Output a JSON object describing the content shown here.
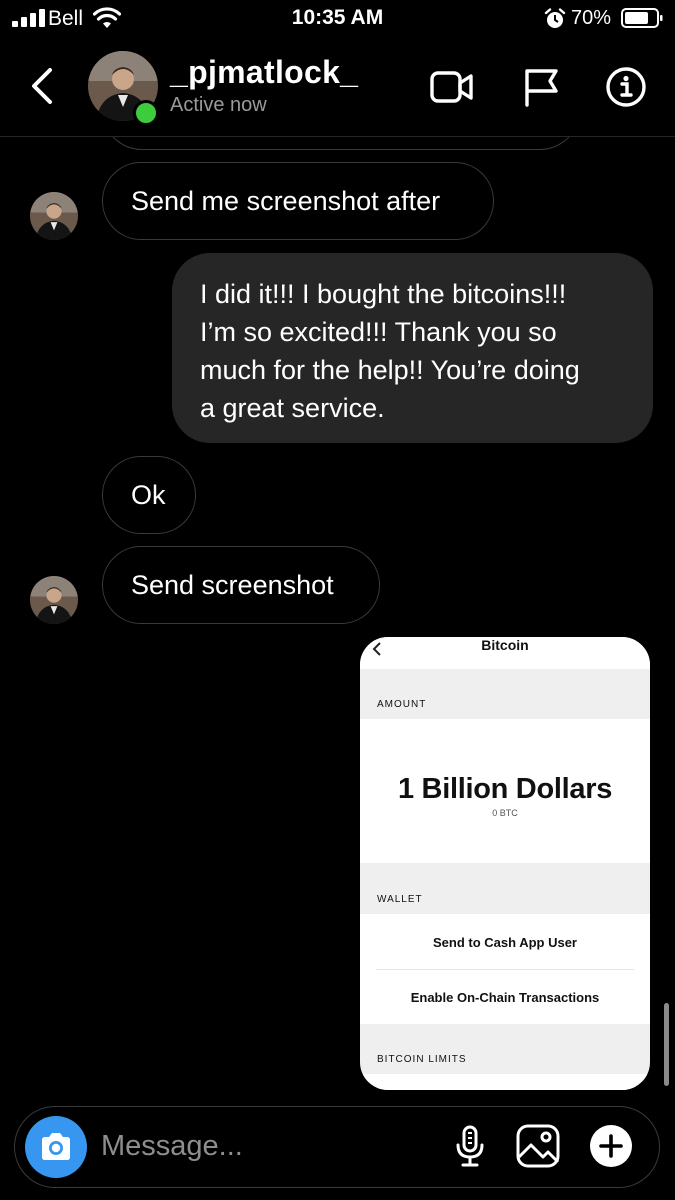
{
  "status_bar": {
    "carrier": "Bell",
    "time": "10:35 AM",
    "battery": "70%"
  },
  "header": {
    "username": "_pjmatlock_",
    "status": "Active now"
  },
  "messages": [
    {
      "from": "them",
      "text": "Send me screenshot after"
    },
    {
      "from": "me",
      "lines": [
        "I did it!!! I bought the bitcoins!!!",
        "I’m so excited!!! Thank you so",
        "much for the help!! You’re doing",
        "a great service."
      ]
    },
    {
      "from": "them",
      "text": "Ok"
    },
    {
      "from": "them",
      "text": "Send screenshot"
    }
  ],
  "shared_image": {
    "title": "Bitcoin",
    "amount_label": "AMOUNT",
    "amount": "1 Billion Dollars",
    "amount_sub": "0 BTC",
    "wallet_label": "WALLET",
    "link_send": "Send to Cash App User",
    "link_chain": "Enable On-Chain Transactions",
    "limits_label": "BITCOIN LIMITS"
  },
  "composer": {
    "placeholder": "Message..."
  },
  "colors": {
    "online": "#3ccc3c",
    "camera_button": "#3797f0",
    "link": "#1ab4d6",
    "outgoing_bubble": "#262626"
  }
}
